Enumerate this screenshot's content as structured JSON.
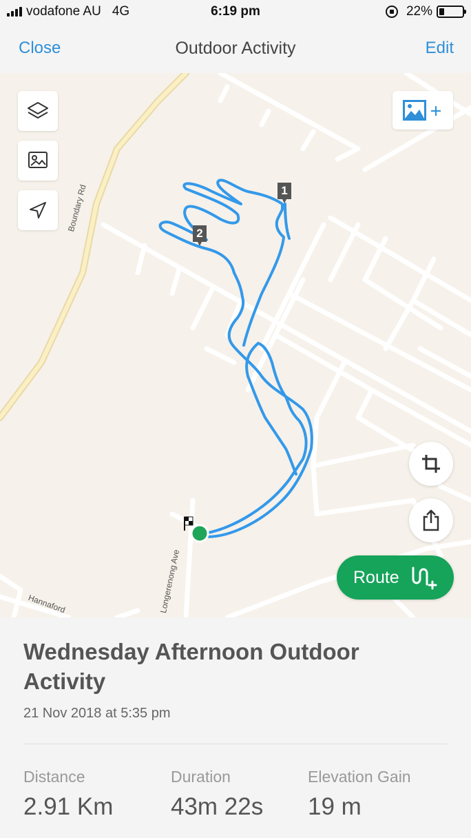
{
  "status_bar": {
    "carrier": "vodafone AU",
    "network": "4G",
    "time": "6:19 pm",
    "battery_percent": "22%",
    "battery_level": 0.22
  },
  "nav": {
    "close_label": "Close",
    "title": "Outdoor Activity",
    "edit_label": "Edit"
  },
  "map": {
    "roads": [
      "Boundary Rd",
      "Longerenong Ave",
      "Hannaford"
    ],
    "markers": [
      "1",
      "2"
    ],
    "route_label": "Route",
    "colors": {
      "track": "#3399ea",
      "start_dot": "#1fa55a",
      "route_button": "#16a35a"
    }
  },
  "activity": {
    "title": "Wednesday Afternoon Outdoor Activity",
    "date": "21 Nov 2018 at 5:35 pm",
    "stats": [
      {
        "label": "Distance",
        "value": "2.91 Km"
      },
      {
        "label": "Duration",
        "value": "43m 22s"
      },
      {
        "label": "Elevation Gain",
        "value": "19 m"
      }
    ]
  }
}
